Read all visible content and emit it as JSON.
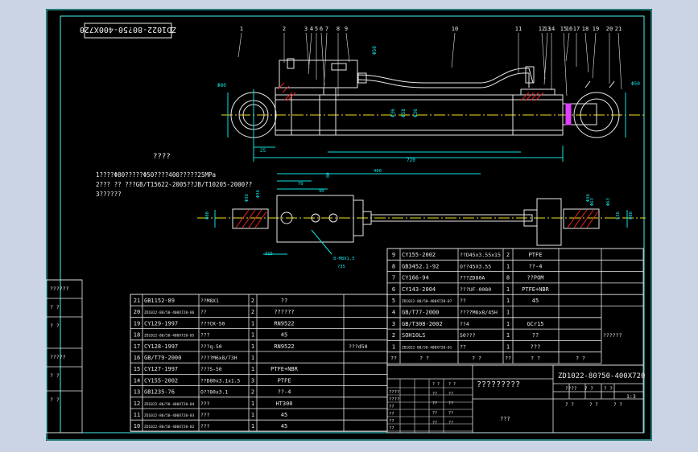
{
  "colors": {
    "background": "#cad4e4",
    "sheet": "#000000",
    "frame": "#4cf0f0",
    "outline": "#e8e8e8",
    "dimension": "#10e0e0",
    "hatch": "#f02020",
    "center": "#f0e020",
    "text": "#f0f0f0",
    "accent": "#e040ff",
    "table_text": "#e8e8e8"
  },
  "sheet": {
    "stamp_code": "ZD1022-80?50-400X720"
  },
  "balloons": [
    "1",
    "2",
    "3",
    "4",
    "5",
    "6",
    "7",
    "8",
    "9",
    "10",
    "11",
    "12",
    "13",
    "14",
    "15",
    "16",
    "17",
    "18",
    "19",
    "20",
    "21"
  ],
  "dims_top": [
    "Φ80",
    "Φ50",
    "Φ36",
    "Φ58",
    "Φ36",
    "25",
    "720",
    "Φ50"
  ],
  "dims_bottom": [
    "Φ36",
    "Φ36",
    "400",
    "Φ80",
    "70",
    "90",
    "80",
    "Φ36",
    "Φ63",
    "Φ63",
    "Φ36",
    "Φ80",
    "315",
    "8-M8X1.5",
    "?35"
  ],
  "notes": {
    "heading": "????",
    "line1": "1????Φ80?????Φ50????400?????25MPa",
    "line2": "2??? ?? ???GB/T15622-2005??JB/T10205-2000??",
    "line3": "3??????"
  },
  "side_labels": [
    "??????",
    "? ?",
    "? ?",
    "?????",
    "? ?",
    "? ?"
  ],
  "bom_left": [
    {
      "no": "21",
      "code": "GB1152-89",
      "name": "??M8X1",
      "qty": "2",
      "mat": "??",
      "note": ""
    },
    {
      "no": "20",
      "code": "ZD1022-80/50-400X720-06",
      "name": "??",
      "qty": "2",
      "mat": "??????",
      "note": ""
    },
    {
      "no": "19",
      "code": "CY129-1997",
      "name": "???CK-50",
      "qty": "1",
      "mat": "RN9522",
      "note": ""
    },
    {
      "no": "18",
      "code": "ZD1022-80/50-400X720-05",
      "name": "???",
      "qty": "1",
      "mat": "45",
      "note": ""
    },
    {
      "no": "17",
      "code": "CY128-1997",
      "name": "???q-50",
      "qty": "1",
      "mat": "RN9522",
      "note": "???d50"
    },
    {
      "no": "16",
      "code": "GB/T79-2000",
      "name": "????M6x8/73H",
      "qty": "1",
      "mat": "",
      "note": ""
    },
    {
      "no": "15",
      "code": "CY127-1997",
      "name": "???S-50",
      "qty": "1",
      "mat": "PTFE+NBR",
      "note": ""
    },
    {
      "no": "14",
      "code": "CY155-2002",
      "name": "??D80x3.1x1.5",
      "qty": "3",
      "mat": "PTFE",
      "note": ""
    },
    {
      "no": "13",
      "code": "GB1235-76",
      "name": "O??80x3.1",
      "qty": "2",
      "mat": "??-4",
      "note": ""
    },
    {
      "no": "12",
      "code": "ZD1022-80/50-400X720-04",
      "name": "???",
      "qty": "1",
      "mat": "HT300",
      "note": ""
    },
    {
      "no": "11",
      "code": "ZD1022-80/50-400X720-03",
      "name": "???",
      "qty": "1",
      "mat": "45",
      "note": ""
    },
    {
      "no": "10",
      "code": "ZD1022-80/50-400X720-02",
      "name": "???",
      "qty": "1",
      "mat": "45",
      "note": ""
    }
  ],
  "bom_right": [
    {
      "no": "9",
      "code": "CY155-2002",
      "name": "??D45x3.55x15",
      "qty": "2",
      "mat": "PTFE",
      "note": ""
    },
    {
      "no": "8",
      "code": "GB3452.1-92",
      "name": "O??45X3.55",
      "qty": "1",
      "mat": "??-4",
      "note": ""
    },
    {
      "no": "7",
      "code": "CY166-94",
      "name": "???ZD80A",
      "qty": "8",
      "mat": "??POM",
      "note": ""
    },
    {
      "no": "6",
      "code": "CY143-2004",
      "name": "???UF-0080",
      "qty": "1",
      "mat": "PTFE+NBR",
      "note": ""
    },
    {
      "no": "5",
      "code": "ZD1022-80/50-400X720-07",
      "name": "??",
      "qty": "1",
      "mat": "45",
      "note": ""
    },
    {
      "no": "4",
      "code": "GB/T77-2000",
      "name": "????M6x8/45H",
      "qty": "1",
      "mat": "",
      "note": ""
    },
    {
      "no": "3",
      "code": "GB/T308-2002",
      "name": "??4",
      "qty": "1",
      "mat": "GCr15",
      "note": ""
    },
    {
      "no": "2",
      "code": "SOH10LS",
      "name": "50???",
      "qty": "1",
      "mat": "??",
      "note": "??????"
    },
    {
      "no": "1",
      "code": "ZD1022-80/50-400X720-01",
      "name": "??",
      "qty": "1",
      "mat": "???",
      "note": ""
    }
  ],
  "bom_header": {
    "no": "??",
    "code": "? ?",
    "name": "? ?",
    "qty": "??",
    "mat": "? ?",
    "note": "? ?"
  },
  "title_block": {
    "drawing_name": "?????????",
    "code": "ZD1022-80?50-400X720",
    "company": "???",
    "scale": "1:3",
    "stage_labels": [
      "????",
      "? ?",
      "? ?"
    ],
    "sheet_labels": [
      "? ?",
      "? ?",
      "? ?"
    ],
    "sign_rows": [
      "????",
      "????",
      "??",
      "??",
      "??",
      "??"
    ],
    "small": [
      "? ?",
      "? ?",
      "??",
      "??",
      "??",
      "??",
      "??",
      "??",
      "??",
      "??"
    ]
  }
}
